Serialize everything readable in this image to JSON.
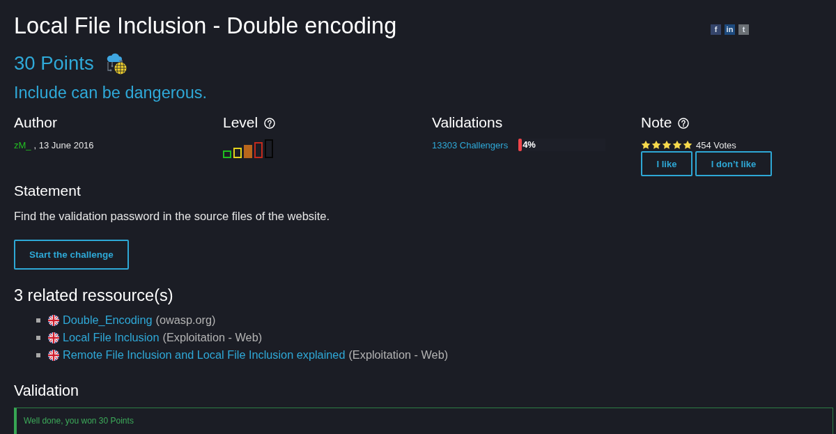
{
  "share_links": [
    {
      "label": "f",
      "color": "#34446a"
    },
    {
      "label": "in",
      "color": "#1d4a7e"
    },
    {
      "label": "t",
      "color": "#6b7075"
    }
  ],
  "title": "Local File Inclusion - Double encoding",
  "points": "30 Points",
  "subtitle": "Include can be dangerous.",
  "info": {
    "author": {
      "heading": "Author",
      "name": "zM_",
      "published": ", 13 June 2016"
    },
    "level": {
      "heading": "Level",
      "bars": [
        {
          "color": "#1fbf1f",
          "filled": false
        },
        {
          "color": "#e3d21c",
          "filled": false
        },
        {
          "color": "#b8661c",
          "filled": true
        },
        {
          "color": "#c42a1c",
          "filled": false
        },
        {
          "color": "#050505",
          "filled": false
        }
      ]
    },
    "validations": {
      "heading": "Validations",
      "challengers": "13303 Challengers",
      "level": 0.04,
      "percent": "4%"
    },
    "note": {
      "heading": "Note",
      "stars": 5,
      "votes": "454 Votes",
      "buttons": [
        "I like",
        "I don’t like"
      ]
    }
  },
  "statement": {
    "heading": "Statement",
    "text": "Find the validation password in the source files of the website.",
    "button": "Start the challenge"
  },
  "resources": {
    "heading": "3 related ressource(s)",
    "items": [
      {
        "link": "Double_Encoding",
        "source": "(owasp.org)"
      },
      {
        "link": "Local File Inclusion",
        "source": "(Exploitation - Web)"
      },
      {
        "link": "Remote File Inclusion and Local File Inclusion explained",
        "source": "(Exploitation - Web)"
      }
    ]
  },
  "validation": {
    "heading": "Validation",
    "message": "Well done, you won 30 Points"
  }
}
